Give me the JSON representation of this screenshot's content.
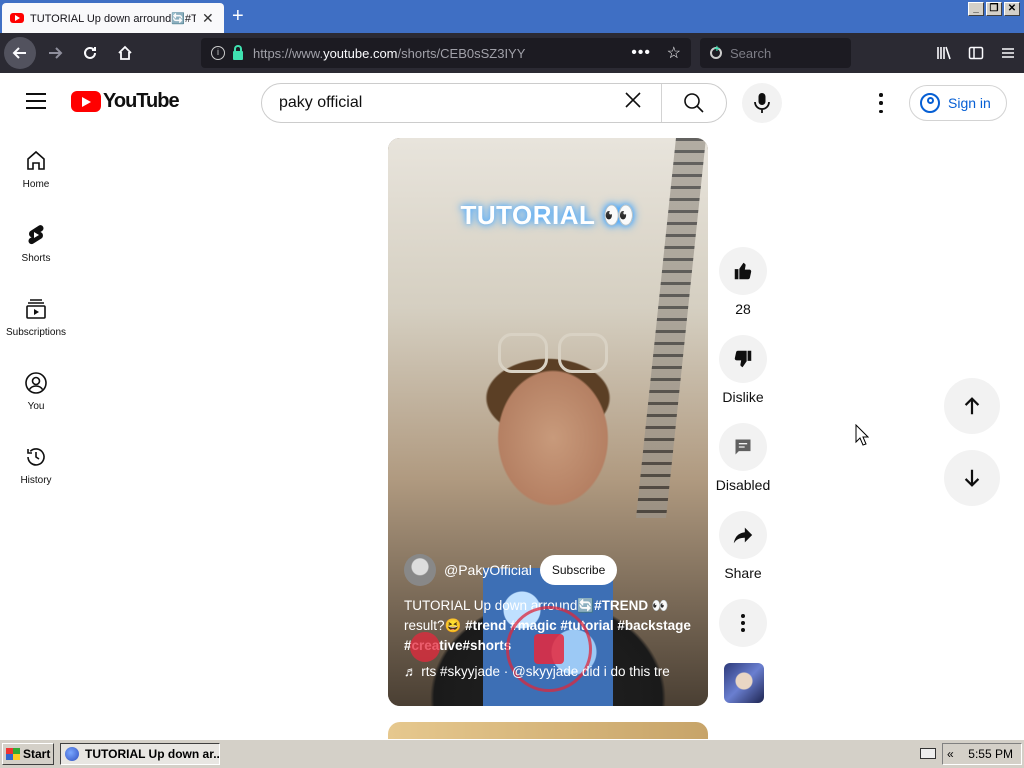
{
  "browser": {
    "tab_title": "TUTORIAL Up down arround🔄#TR",
    "tab_close": "✕",
    "new_tab": "+",
    "url_prefix": "https://www.",
    "url_domain": "youtube.com",
    "url_path": "/shorts/CEB0sSZ3IYY",
    "page_actions": "•••",
    "search_placeholder": "Search",
    "window_controls": [
      "_",
      "❐",
      "✕"
    ]
  },
  "youtube": {
    "logo_text": "YouTube",
    "search_query": "paky official",
    "signin_label": "Sign in",
    "sidebar": [
      {
        "label": "Home",
        "icon": "home-icon"
      },
      {
        "label": "Shorts",
        "icon": "shorts-icon"
      },
      {
        "label": "Subscriptions",
        "icon": "subscriptions-icon"
      },
      {
        "label": "You",
        "icon": "you-icon"
      },
      {
        "label": "History",
        "icon": "history-icon"
      }
    ],
    "short": {
      "overlay_title": "TUTORIAL 👀",
      "channel_handle": "@PakyOfficial",
      "subscribe_label": "Subscribe",
      "caption_line1": "TUTORIAL Up down arround🔄",
      "caption_tag1": "#TREND",
      "caption_emoji1": " 👀",
      "caption_line2": "result?😆 ",
      "caption_tags2": "#trend #magic #tutorial #backstage",
      "caption_tags3": "#creative#shorts",
      "music_text": "♬ rts #skyyjade · @skyyjade    did i do this tre"
    },
    "actions": {
      "like_count": "28",
      "dislike_label": "Dislike",
      "comments_label": "Disabled",
      "share_label": "Share"
    }
  },
  "taskbar": {
    "start_label": "Start",
    "task_label": "TUTORIAL Up down ar...",
    "tray_arrows": "«",
    "clock": "5:55 PM"
  },
  "colors": {
    "yt_red": "#ff0000",
    "link_blue": "#065fd4",
    "browser_dark": "#2b2a33",
    "tab_strip": "#3f6fc4"
  }
}
